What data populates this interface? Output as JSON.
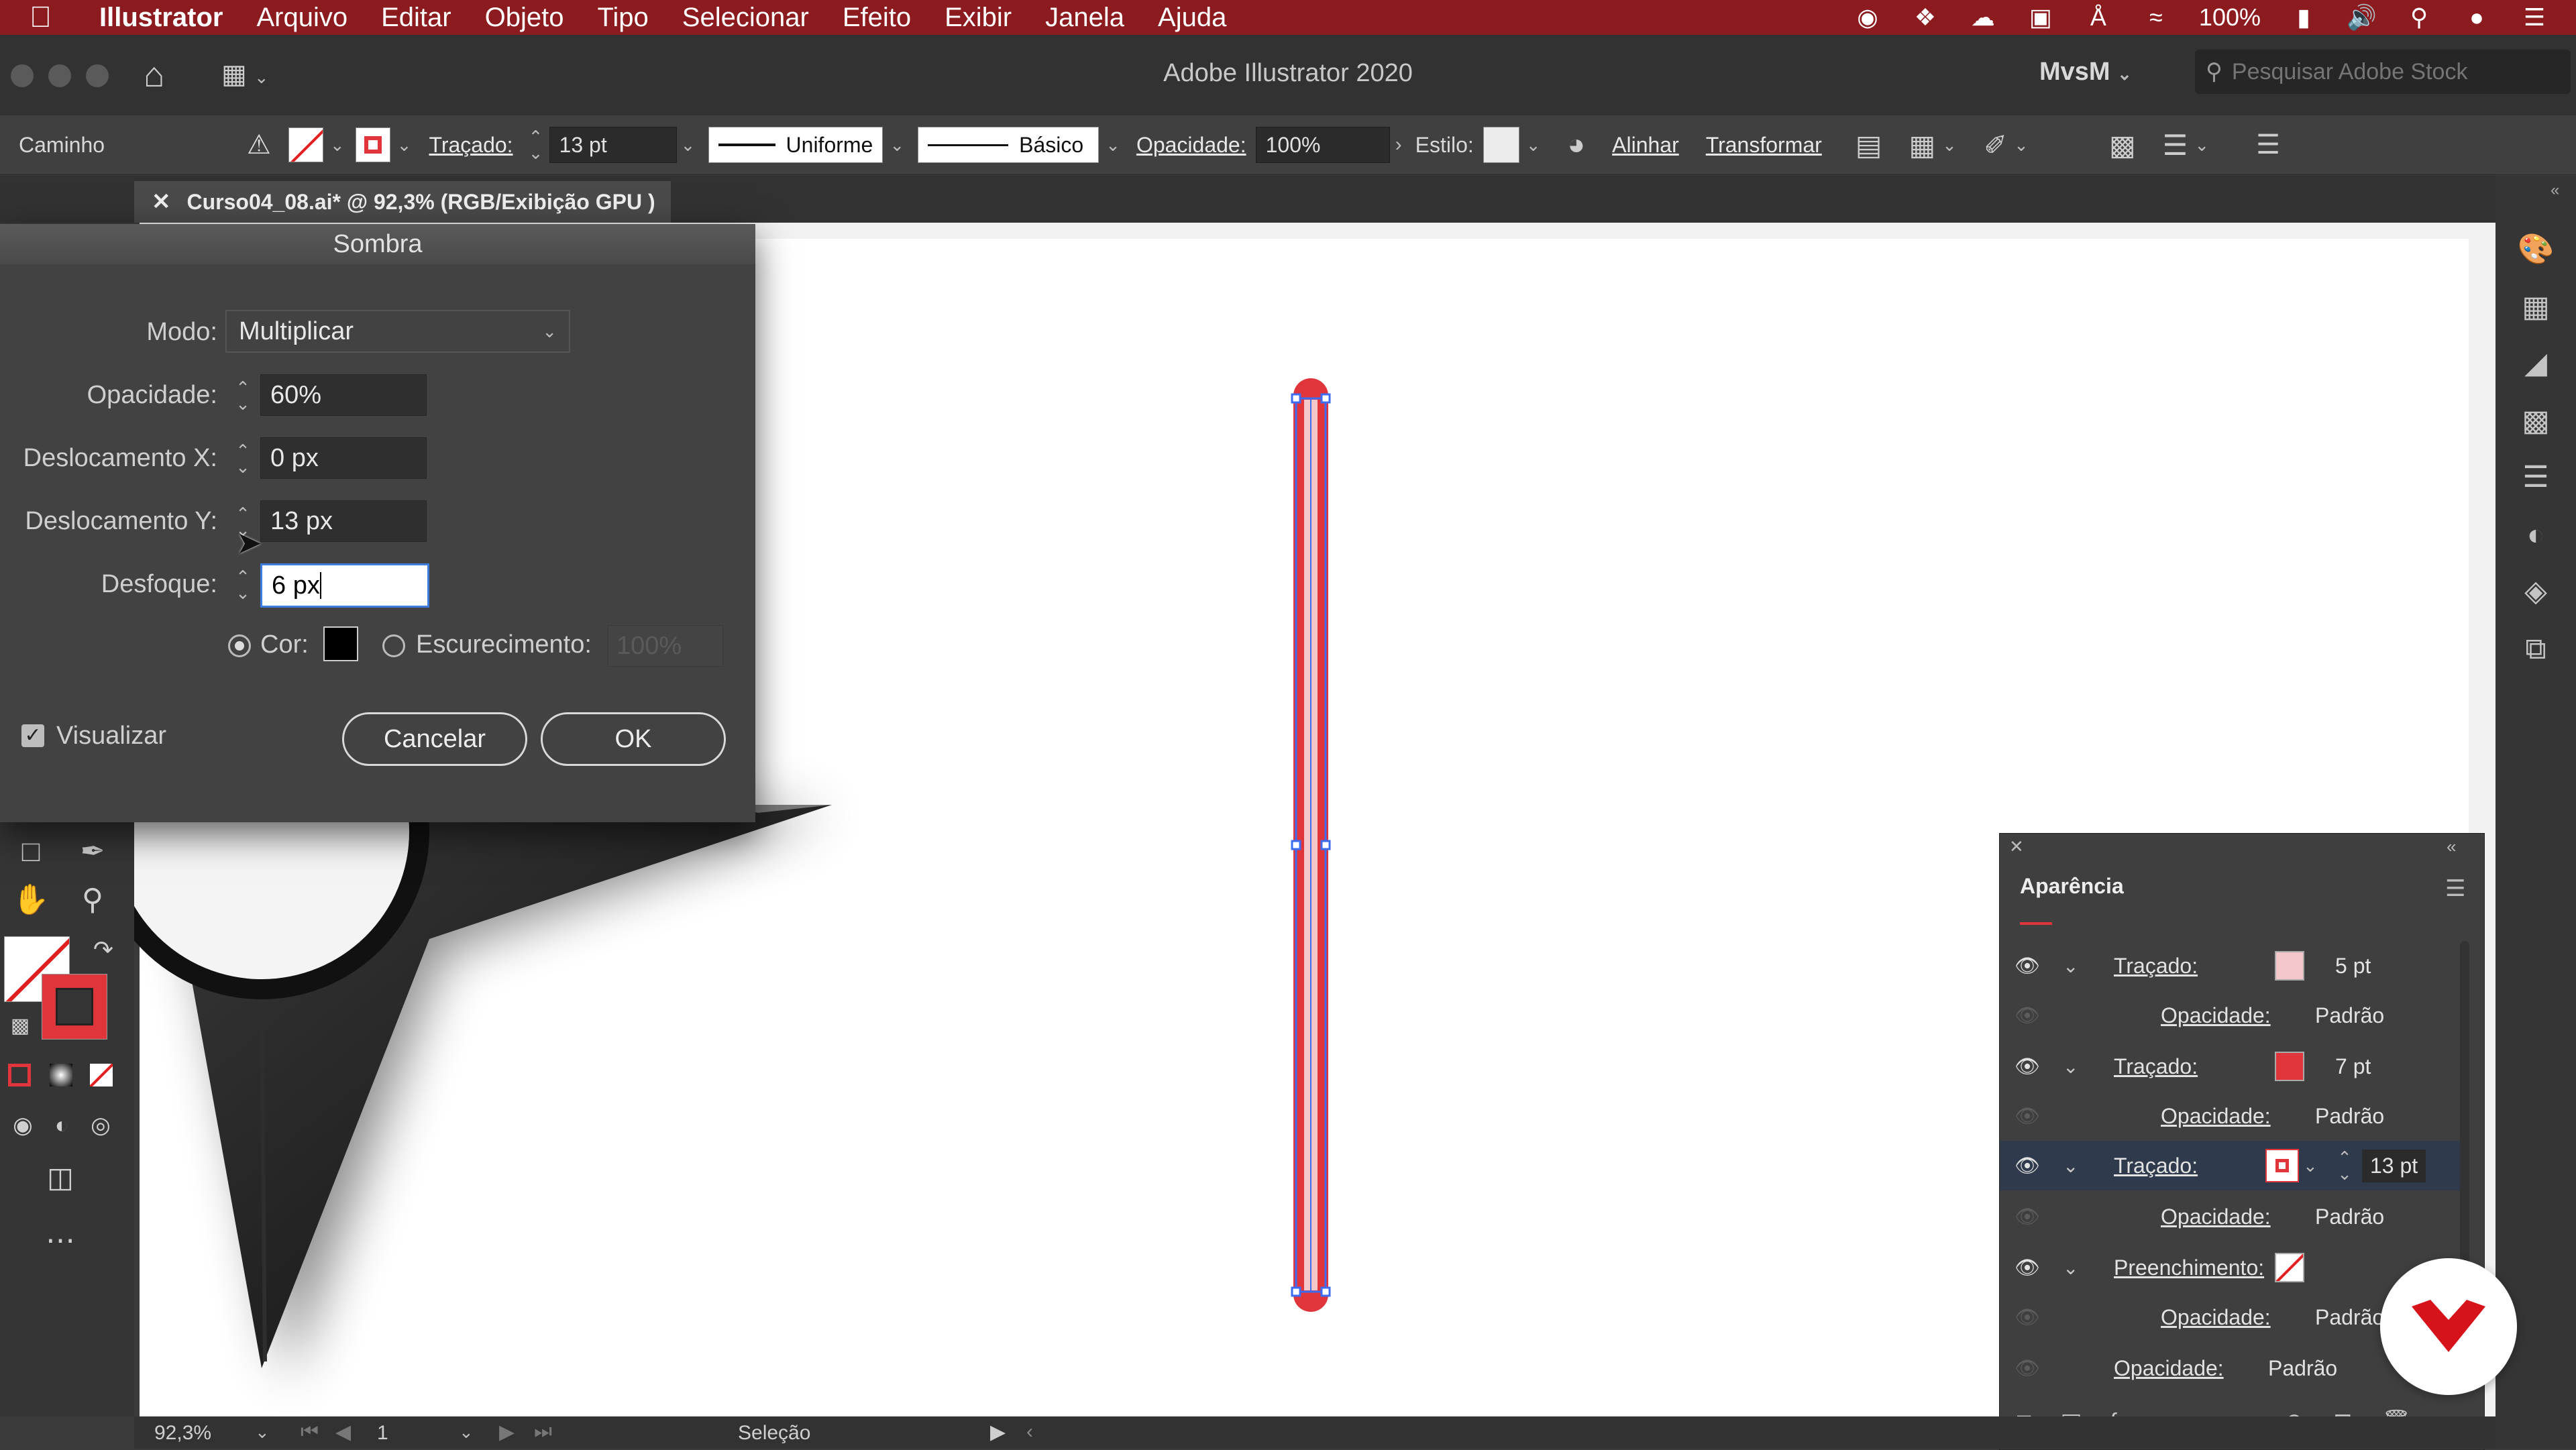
{
  "menubar": {
    "app_name": "Illustrator",
    "items": [
      "Arquivo",
      "Editar",
      "Objeto",
      "Tipo",
      "Selecionar",
      "Efeito",
      "Exibir",
      "Janela",
      "Ajuda"
    ],
    "battery": "100%"
  },
  "appbar": {
    "title": "Adobe Illustrator 2020",
    "workspace": "MvsM",
    "stock_search_placeholder": "Pesquisar Adobe Stock"
  },
  "controlbar": {
    "selection_type": "Caminho",
    "stroke_label": "Traçado:",
    "stroke_weight": "13 pt",
    "profile": "Uniforme",
    "brush": "Básico",
    "opacity_label": "Opacidade:",
    "opacity": "100%",
    "style_label": "Estilo:",
    "align": "Alinhar",
    "transform": "Transformar"
  },
  "document": {
    "tab_title": "Curso04_08.ai* @ 92,3% (RGB/Exibição GPU )"
  },
  "dialog": {
    "title": "Sombra",
    "mode_label": "Modo:",
    "mode_value": "Multiplicar",
    "opacity_label": "Opacidade:",
    "opacity_value": "60%",
    "offset_x_label": "Deslocamento X:",
    "offset_x_value": "0 px",
    "offset_y_label": "Deslocamento Y:",
    "offset_y_value": "13 px",
    "blur_label": "Desfoque:",
    "blur_value": "6 px",
    "color_label": "Cor:",
    "darkness_label": "Escurecimento:",
    "darkness_value": "100%",
    "preview_label": "Visualizar",
    "cancel": "Cancelar",
    "ok": "OK"
  },
  "appearance": {
    "title": "Aparência",
    "rows": [
      {
        "label": "Traçado:",
        "value": "5 pt",
        "swatch": "#f4c7cb"
      },
      {
        "label": "Opacidade:",
        "value": "Padrão"
      },
      {
        "label": "Traçado:",
        "value": "7 pt",
        "swatch": "#e0353b"
      },
      {
        "label": "Opacidade:",
        "value": "Padrão"
      },
      {
        "label": "Traçado:",
        "value": "13 pt",
        "swatch": "#e0353b"
      },
      {
        "label": "Opacidade:",
        "value": "Padrão"
      },
      {
        "label": "Preenchimento:",
        "value": ""
      },
      {
        "label": "Opacidade:",
        "value": "Padrão"
      },
      {
        "label": "Opacidade:",
        "value": "Padrão"
      }
    ],
    "fx_label": "fx."
  },
  "statusbar": {
    "zoom": "92,3%",
    "artboard": "1",
    "tool": "Seleção"
  },
  "colors": {
    "menubar": "#8c1b1f",
    "accent_red": "#e0353b",
    "light_pink": "#f4c7cb",
    "selection_blue": "#3d6cf0"
  }
}
